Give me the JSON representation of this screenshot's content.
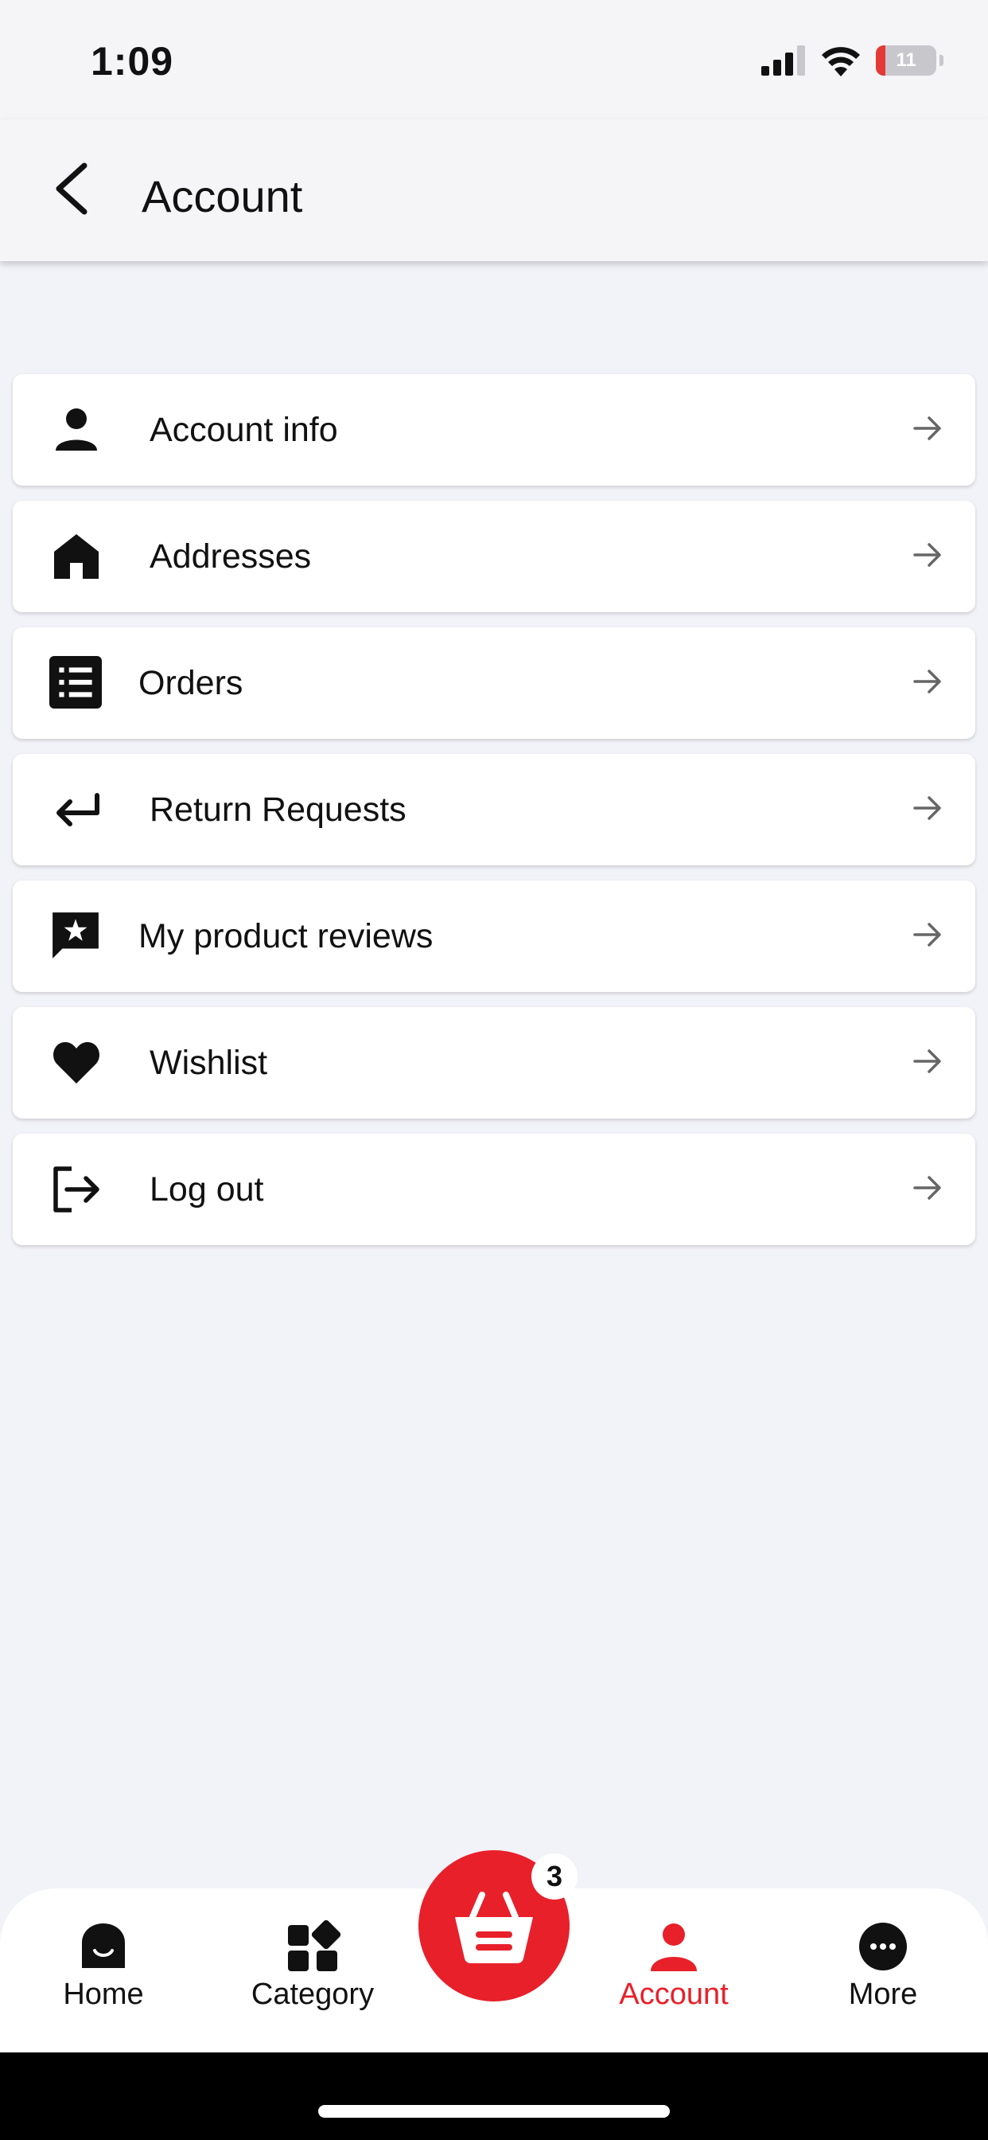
{
  "status": {
    "time": "1:09",
    "battery": "11"
  },
  "header": {
    "title": "Account"
  },
  "menu": [
    {
      "label": "Account info",
      "icon": "person-icon"
    },
    {
      "label": "Addresses",
      "icon": "home-icon"
    },
    {
      "label": "Orders",
      "icon": "list-icon"
    },
    {
      "label": "Return Requests",
      "icon": "return-icon"
    },
    {
      "label": "My product reviews",
      "icon": "review-star-icon"
    },
    {
      "label": "Wishlist",
      "icon": "heart-icon"
    },
    {
      "label": "Log out",
      "icon": "logout-icon"
    }
  ],
  "nav": {
    "home": "Home",
    "category": "Category",
    "account": "Account",
    "more": "More",
    "cart_count": "3"
  },
  "colors": {
    "accent": "#e8202a",
    "background": "#f2f3f8"
  }
}
